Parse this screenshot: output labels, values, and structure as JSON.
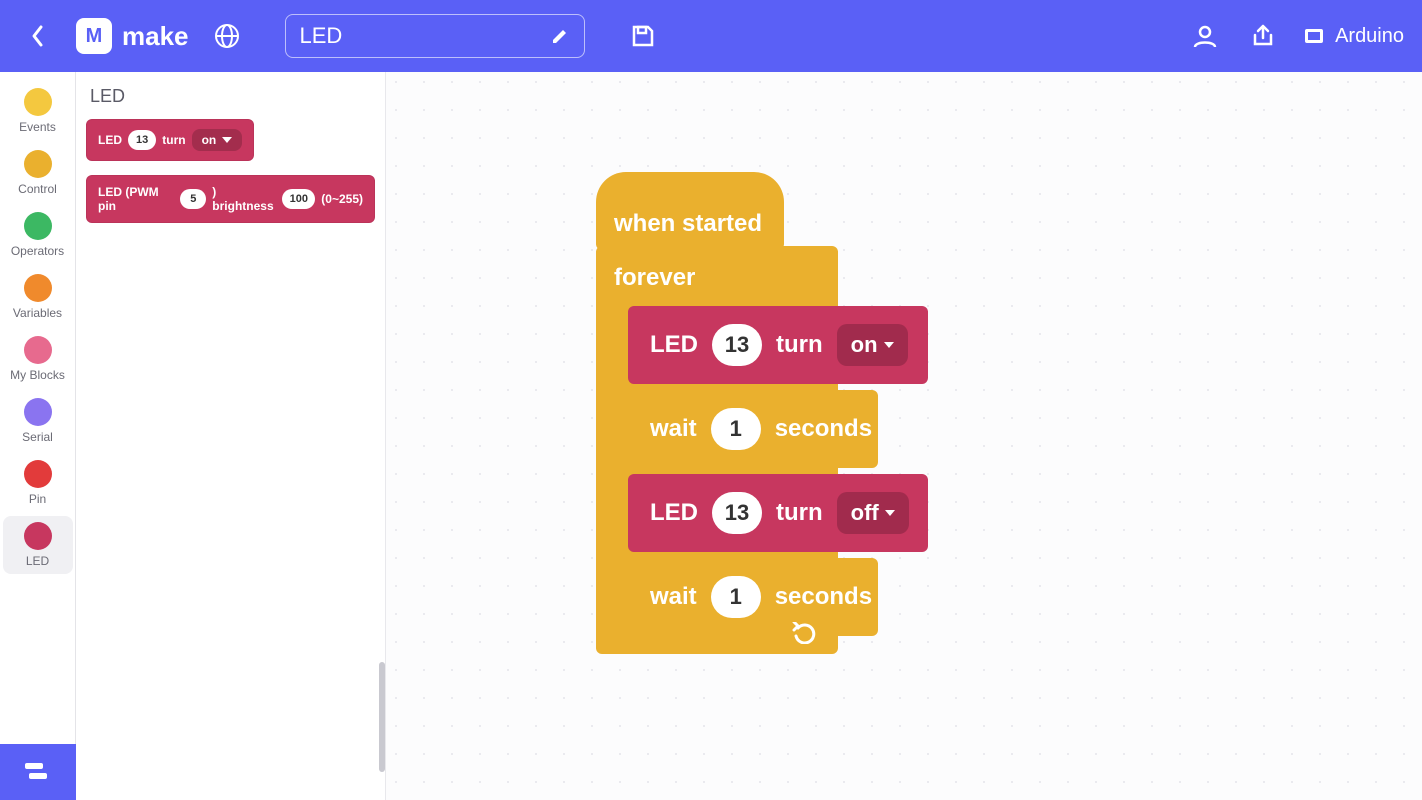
{
  "header": {
    "logo_text": "make",
    "project_name": "LED",
    "device_label": "Arduino"
  },
  "sidebar": {
    "categories": [
      {
        "label": "Events",
        "color": "#f4c83f"
      },
      {
        "label": "Control",
        "color": "#eab02e"
      },
      {
        "label": "Operators",
        "color": "#3cb863"
      },
      {
        "label": "Variables",
        "color": "#f08a2c"
      },
      {
        "label": "My Blocks",
        "color": "#e76a8e"
      },
      {
        "label": "Serial",
        "color": "#8a74f0"
      },
      {
        "label": "Pin",
        "color": "#e23b3b"
      },
      {
        "label": "LED",
        "color": "#c7375f"
      }
    ],
    "active_index": 7
  },
  "palette": {
    "title": "LED",
    "block_led_turn": {
      "prefix": "LED",
      "pin": "13",
      "mid": "turn",
      "state": "on"
    },
    "block_led_pwm": {
      "prefix": "LED (PWM pin",
      "pin": "5",
      "mid": ") brightness",
      "val": "100",
      "suffix": "(0~255)"
    }
  },
  "script": {
    "hat_label": "when started",
    "forever_label": "forever",
    "blocks": [
      {
        "type": "led",
        "prefix": "LED",
        "pin": "13",
        "mid": "turn",
        "state": "on"
      },
      {
        "type": "wait",
        "prefix": "wait",
        "val": "1",
        "suffix": "seconds"
      },
      {
        "type": "led",
        "prefix": "LED",
        "pin": "13",
        "mid": "turn",
        "state": "off"
      },
      {
        "type": "wait",
        "prefix": "wait",
        "val": "1",
        "suffix": "seconds"
      }
    ]
  }
}
